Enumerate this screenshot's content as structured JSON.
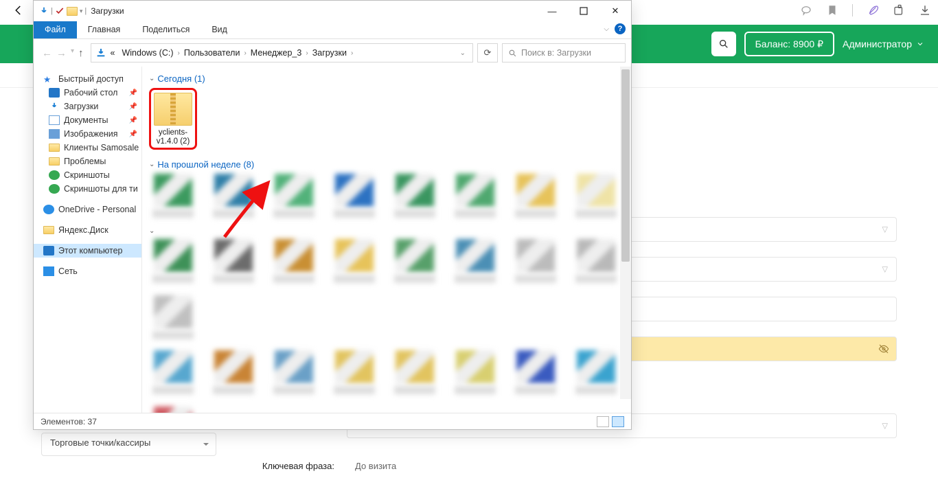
{
  "chrome": {
    "bubble": "chat",
    "bookmark": "bookmark",
    "feather": "feather",
    "ext": "extensions",
    "dl": "download"
  },
  "header": {
    "balance_label": "Баланс: 8900 ₽",
    "admin_label": "Администратор"
  },
  "web": {
    "left_select": "Торговые точки/кассиры",
    "key_phrase_label": "Ключевая фраза:",
    "key_phrase_value": "До визита"
  },
  "explorer": {
    "title": "Загрузки",
    "tabs": {
      "file": "Файл",
      "home": "Главная",
      "share": "Поделиться",
      "view": "Вид"
    },
    "crumbs": [
      "Windows (C:)",
      "Пользователи",
      "Менеджер_3",
      "Загрузки"
    ],
    "crumb_prefix": "«",
    "search_placeholder": "Поиск в: Загрузки",
    "nav": {
      "quick": "Быстрый доступ",
      "desktop": "Рабочий стол",
      "downloads": "Загрузки",
      "documents": "Документы",
      "pictures": "Изображения",
      "clients": "Клиенты Samosale",
      "problems": "Проблемы",
      "screenshots": "Скриншоты",
      "screenshots_ti": "Скриншоты для ти",
      "onedrive": "OneDrive - Personal",
      "yadisk": "Яндекс.Диск",
      "thispc": "Этот компьютер",
      "network": "Сеть"
    },
    "groups": {
      "today": "Сегодня (1)",
      "lastweek": "На прошлой неделе (8)"
    },
    "zip_name": "yclients-v1.4.0 (2)",
    "status": "Элементов: 37"
  },
  "blur_palette": {
    "row1": [
      "#3c9a5f",
      "#2f7fa8",
      "#52b27a",
      "#2c72c2",
      "#3a9660",
      "#4fa86f",
      "#e7c35a",
      "#efe3a6"
    ],
    "row2": [
      "#3e9158",
      "#6c6c6c",
      "#c98f33",
      "#e7c35a",
      "#57a06a",
      "#4b8fb5",
      "#bcbcbc",
      "#b9b9b9",
      "#c0c0c0"
    ],
    "row3": [
      "#57a7cf",
      "#c98435",
      "#6aa0c7",
      "#e2c45f",
      "#e2c45f",
      "#d8cf70",
      "#3a5bc0",
      "#3aa3cf",
      "#cf5a62"
    ]
  }
}
